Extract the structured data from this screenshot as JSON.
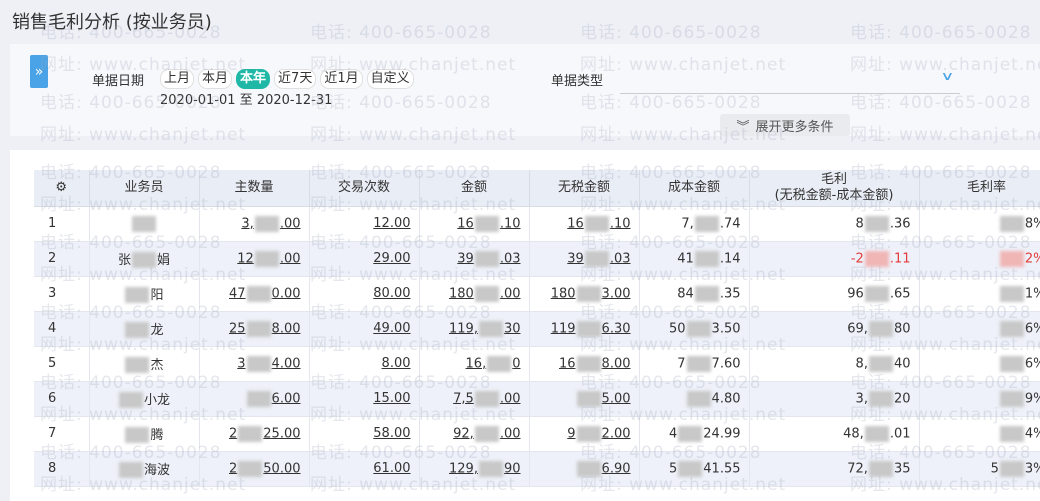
{
  "page": {
    "title": "销售毛利分析 (按业务员)"
  },
  "filters": {
    "expand_icon": "double-chevron-right-icon",
    "expand_glyph": "»",
    "date_label": "单据日期",
    "date_options": [
      {
        "label": "上月",
        "active": false
      },
      {
        "label": "本月",
        "active": false
      },
      {
        "label": "本年",
        "active": true
      },
      {
        "label": "近7天",
        "active": false
      },
      {
        "label": "近1月",
        "active": false
      },
      {
        "label": "自定义",
        "active": false
      }
    ],
    "date_range": "2020-01-01 至 2020-12-31",
    "type_label": "单据类型",
    "type_value": "",
    "more_button": "展开更多条件",
    "more_glyph": "︾"
  },
  "table": {
    "settings_glyph": "⚙",
    "columns": [
      "业务员",
      "主数量",
      "交易次数",
      "金额",
      "无税金额",
      "成本金额",
      "毛利",
      "毛利率"
    ],
    "profit_subtitle": "(无税金额-成本金额)",
    "rows": [
      {
        "idx": "1",
        "name_a": "",
        "name_b": "",
        "qty_a": "3,",
        "qty_b": ".00",
        "times": "12.00",
        "amt_a": "16",
        "amt_b": ".10",
        "net_a": "16",
        "net_b": ".10",
        "cost_a": "7,",
        "cost_b": ".74",
        "profit_a": "8",
        "profit_b": ".36",
        "rate_a": "",
        "rate_b": "8%",
        "neg": false
      },
      {
        "idx": "2",
        "name_a": "张",
        "name_b": "娟",
        "qty_a": "12",
        "qty_b": ".00",
        "times": "29.00",
        "amt_a": "39",
        "amt_b": ".03",
        "net_a": "39",
        "net_b": ".03",
        "cost_a": "41",
        "cost_b": ".14",
        "profit_a": "-2",
        "profit_b": ".11",
        "rate_a": "",
        "rate_b": "2%",
        "neg": true
      },
      {
        "idx": "3",
        "name_a": "",
        "name_b": "阳",
        "qty_a": "47",
        "qty_b": "0.00",
        "times": "80.00",
        "amt_a": "180",
        "amt_b": ".00",
        "net_a": "180",
        "net_b": "3.00",
        "cost_a": "84",
        "cost_b": ".35",
        "profit_a": "96",
        "profit_b": ".65",
        "rate_a": "",
        "rate_b": "1%",
        "neg": false
      },
      {
        "idx": "4",
        "name_a": "",
        "name_b": "龙",
        "qty_a": "25",
        "qty_b": "8.00",
        "times": "49.00",
        "amt_a": "119,",
        "amt_b": "30",
        "net_a": "119",
        "net_b": "6.30",
        "cost_a": "50",
        "cost_b": "3.50",
        "profit_a": "69,",
        "profit_b": "80",
        "rate_a": "",
        "rate_b": "6%",
        "neg": false
      },
      {
        "idx": "5",
        "name_a": "",
        "name_b": "杰",
        "qty_a": "3",
        "qty_b": "4.00",
        "times": "8.00",
        "amt_a": "16,",
        "amt_b": "0",
        "net_a": "16",
        "net_b": "8.00",
        "cost_a": "7",
        "cost_b": "7.60",
        "profit_a": "8,",
        "profit_b": "40",
        "rate_a": "",
        "rate_b": "6%",
        "neg": false
      },
      {
        "idx": "6",
        "name_a": "",
        "name_b": "小龙",
        "qty_a": "",
        "qty_b": "6.00",
        "times": "15.00",
        "amt_a": "7,5",
        "amt_b": ".00",
        "net_a": "",
        "net_b": "5.00",
        "cost_a": "",
        "cost_b": "4.80",
        "profit_a": "3,",
        "profit_b": "20",
        "rate_a": "",
        "rate_b": "9%",
        "neg": false
      },
      {
        "idx": "7",
        "name_a": "",
        "name_b": "腾",
        "qty_a": "2",
        "qty_b": "25.00",
        "times": "58.00",
        "amt_a": "92,",
        "amt_b": ".00",
        "net_a": "9",
        "net_b": "2.00",
        "cost_a": "4",
        "cost_b": "24.99",
        "profit_a": "48,",
        "profit_b": ".01",
        "rate_a": "",
        "rate_b": "4%",
        "neg": false
      },
      {
        "idx": "8",
        "name_a": "",
        "name_b": "海波",
        "qty_a": "2",
        "qty_b": "50.00",
        "times": "61.00",
        "amt_a": "129,",
        "amt_b": "90",
        "net_a": "",
        "net_b": "6.90",
        "cost_a": "5",
        "cost_b": "41.55",
        "profit_a": "72,",
        "profit_b": "35",
        "rate_a": "5",
        "rate_b": "3%",
        "neg": false
      }
    ]
  },
  "watermark": {
    "phone": "电话: 400-665-0028",
    "site": "网址: www.chanjet.net"
  }
}
